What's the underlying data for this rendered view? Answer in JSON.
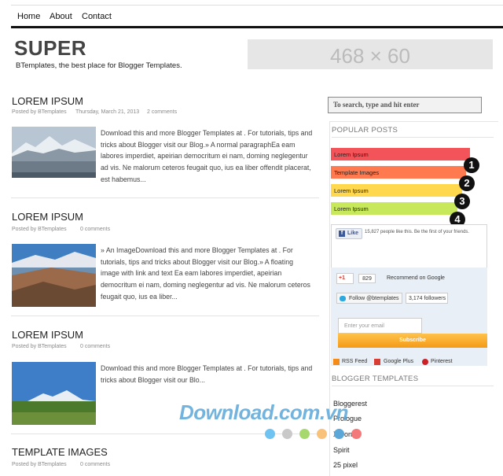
{
  "nav": {
    "items": [
      "Home",
      "About",
      "Contact"
    ]
  },
  "header": {
    "title": "SUPER",
    "description": "BTemplates, the best place for Blogger Templates.",
    "banner": "468 × 60"
  },
  "posts": [
    {
      "title": "LOREM IPSUM",
      "author": "Posted by BTemplates",
      "date": "Thursday, March 21, 2013",
      "comments": "2 comments",
      "excerpt": "Download this and more Blogger Templates at . For tutorials, tips and tricks about Blogger visit our Blog.» A normal paragraphEa eam labores imperdiet, apeirian democritum ei nam, doming neglegentur ad vis. Ne malorum ceteros feugait quo, ius ea liber offendit placerat, est habemus..."
    },
    {
      "title": "LOREM IPSUM",
      "author": "Posted by BTemplates",
      "date": "",
      "comments": "0 comments",
      "excerpt": "» An ImageDownload this and more Blogger Templates at . For tutorials, tips and tricks about Blogger visit our Blog.» A floating image with link and text Ea eam labores imperdiet, apeirian democritum ei nam, doming neglegentur ad vis. Ne malorum ceteros feugait quo, ius ea liber..."
    },
    {
      "title": "LOREM IPSUM",
      "author": "Posted by BTemplates",
      "date": "",
      "comments": "0 comments",
      "excerpt": "Download this and more Blogger Templates at . For tutorials, tips and tricks about Blogger visit our Blo..."
    },
    {
      "title": "TEMPLATE IMAGES",
      "author": "Posted by BTemplates",
      "date": "",
      "comments": "0 comments",
      "excerpt": ""
    }
  ],
  "sidebar": {
    "search_placeholder": "To search, type and hit enter",
    "popular_title": "POPULAR POSTS",
    "popular": [
      {
        "label": "Lorem Ipsum",
        "color": "#f25459"
      },
      {
        "label": "Template Images",
        "color": "#ff7a4f"
      },
      {
        "label": "Lorem Ipsum",
        "color": "#ffd84d"
      },
      {
        "label": "Lorem Ipsum",
        "color": "#c6e85a"
      }
    ],
    "numbers": [
      "1",
      "2",
      "3",
      "4"
    ],
    "social": {
      "like": "Like",
      "like_text": "15,827 people like this. Be the first of your friends.",
      "gplus": "+1",
      "gplus_count": "829",
      "gplus_text": "Recommend on Google",
      "twitter": "Follow @btemplates",
      "twitter_count": "3,174 followers",
      "email_placeholder": "Enter your email",
      "subscribe": "Subscribe",
      "rss": "RSS Feed",
      "gplus_link": "Google Plus",
      "pinterest": "Pinterest"
    },
    "blogger_title": "BLOGGER TEMPLATES",
    "blogger_items": [
      "Bloggerest",
      "Prologue",
      "Xeron",
      "Spirit",
      "25 pixel"
    ]
  },
  "watermark": "Download.com.vn",
  "colors": {
    "watermark": "#5aa7d8",
    "dots": [
      "#6fc3f0",
      "#c9c9c9",
      "#a7d86e",
      "#f8c27a",
      "#5aa7d8",
      "#f27a7a"
    ]
  }
}
